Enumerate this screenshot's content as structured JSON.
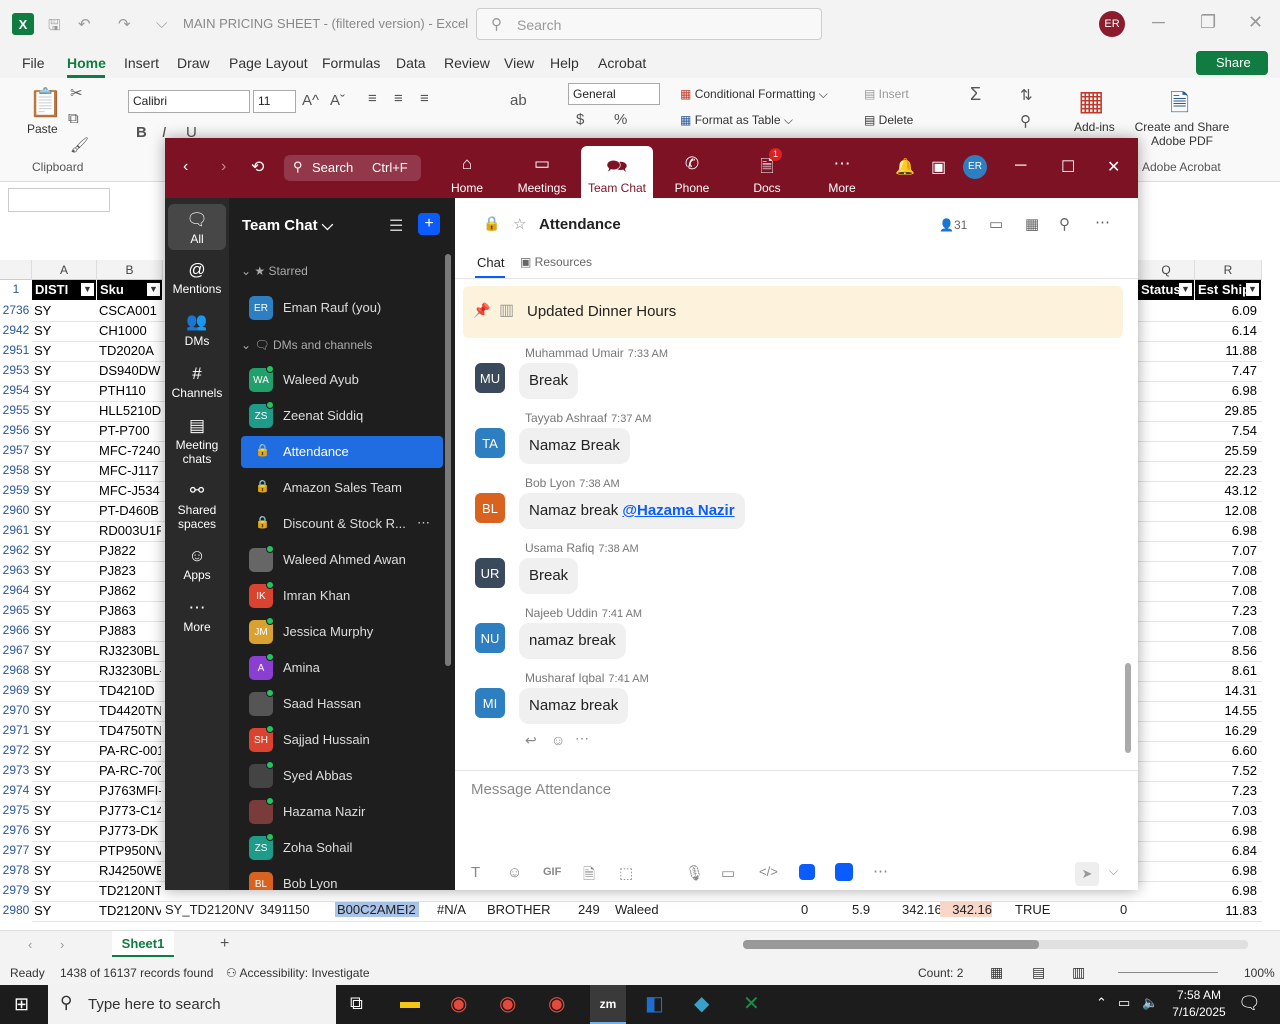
{
  "excel": {
    "title": "MAIN PRICING SHEET - (filtered version)  -  Excel",
    "search_placeholder": "Search",
    "avatar": "ER",
    "tabs": [
      "File",
      "Home",
      "Insert",
      "Draw",
      "Page Layout",
      "Formulas",
      "Data",
      "Review",
      "View",
      "Help",
      "Acrobat"
    ],
    "share": "Share",
    "ribbon": {
      "paste": "Paste",
      "clipboard": "Clipboard",
      "font": "Calibri",
      "size": "11",
      "number_format": "General",
      "conditional": "Conditional Formatting",
      "format_table": "Format as Table",
      "insert": "Insert",
      "delete": "Delete",
      "addins": "Add-ins",
      "create_pdf": "Create and Share Adobe PDF",
      "adobe": "Adobe Acrobat"
    },
    "columns": [
      "A",
      "B",
      "Q",
      "R"
    ],
    "headers": {
      "disti": "DISTI",
      "sku": "Sku",
      "status": "Status",
      "ship": "Est Ship"
    },
    "rows": [
      {
        "n": "2736",
        "a": "SY",
        "b": "CSCA001",
        "r": "6.09"
      },
      {
        "n": "2942",
        "a": "SY",
        "b": "CH1000",
        "r": "6.14"
      },
      {
        "n": "2951",
        "a": "SY",
        "b": "TD2020A",
        "r": "11.88"
      },
      {
        "n": "2953",
        "a": "SY",
        "b": "DS940DW",
        "r": "7.47"
      },
      {
        "n": "2954",
        "a": "SY",
        "b": "PTH110",
        "r": "6.98"
      },
      {
        "n": "2955",
        "a": "SY",
        "b": "HLL5210D",
        "r": "29.85"
      },
      {
        "n": "2956",
        "a": "SY",
        "b": "PT-P700",
        "r": "7.54"
      },
      {
        "n": "2957",
        "a": "SY",
        "b": "MFC-7240",
        "r": "25.59"
      },
      {
        "n": "2958",
        "a": "SY",
        "b": "MFC-J117",
        "r": "22.23"
      },
      {
        "n": "2959",
        "a": "SY",
        "b": "MFC-J534",
        "r": "43.12"
      },
      {
        "n": "2960",
        "a": "SY",
        "b": "PT-D460B",
        "r": "12.08"
      },
      {
        "n": "2961",
        "a": "SY",
        "b": "RD003U1F",
        "r": "6.98"
      },
      {
        "n": "2962",
        "a": "SY",
        "b": "PJ822",
        "r": "7.07"
      },
      {
        "n": "2963",
        "a": "SY",
        "b": "PJ823",
        "r": "7.08"
      },
      {
        "n": "2964",
        "a": "SY",
        "b": "PJ862",
        "r": "7.08"
      },
      {
        "n": "2965",
        "a": "SY",
        "b": "PJ863",
        "r": "7.23"
      },
      {
        "n": "2966",
        "a": "SY",
        "b": "PJ883",
        "r": "7.08"
      },
      {
        "n": "2967",
        "a": "SY",
        "b": "RJ3230BL",
        "r": "8.56"
      },
      {
        "n": "2968",
        "a": "SY",
        "b": "RJ3230BL-",
        "r": "8.61"
      },
      {
        "n": "2969",
        "a": "SY",
        "b": "TD4210D",
        "r": "14.31"
      },
      {
        "n": "2970",
        "a": "SY",
        "b": "TD4420TN",
        "r": "14.55"
      },
      {
        "n": "2971",
        "a": "SY",
        "b": "TD4750TN",
        "r": "16.29"
      },
      {
        "n": "2972",
        "a": "SY",
        "b": "PA-RC-001",
        "r": "6.60"
      },
      {
        "n": "2973",
        "a": "SY",
        "b": "PA-RC-700",
        "r": "7.52"
      },
      {
        "n": "2974",
        "a": "SY",
        "b": "PJ763MFI-",
        "r": "7.23"
      },
      {
        "n": "2975",
        "a": "SY",
        "b": "PJ773-C14",
        "r": "7.03"
      },
      {
        "n": "2976",
        "a": "SY",
        "b": "PJ773-DK",
        "r": "6.98"
      },
      {
        "n": "2977",
        "a": "SY",
        "b": "PTP950NV",
        "r": "6.84"
      },
      {
        "n": "2978",
        "a": "SY",
        "b": "RJ4250WB",
        "r": "6.98"
      },
      {
        "n": "2979",
        "a": "SY",
        "b": "TD2120NT",
        "r": "6.98"
      },
      {
        "n": "2980",
        "a": "SY",
        "b": "TD2120NV",
        "r": "11.83"
      }
    ],
    "row2980_extra": [
      "SY_TD2120NV",
      "3491150",
      "B00C2AMEI2",
      "#N/A",
      "BROTHER",
      "249",
      "Waleed",
      "0",
      "5.9",
      "342.16",
      "342.16",
      "TRUE",
      "0"
    ],
    "sheet_tab": "Sheet1",
    "status": {
      "ready": "Ready",
      "records": "1438 of 16137 records found",
      "access": "Accessibility: Investigate",
      "count": "Count: 2",
      "zoom": "100%"
    }
  },
  "zoom": {
    "search": "Search",
    "search_shortcut": "Ctrl+F",
    "nav": [
      {
        "label": "Home",
        "icon": "home-icon"
      },
      {
        "label": "Meetings",
        "icon": "video-icon"
      },
      {
        "label": "Team Chat",
        "icon": "chat-icon"
      },
      {
        "label": "Phone",
        "icon": "phone-icon"
      },
      {
        "label": "Docs",
        "icon": "doc-icon",
        "badge": "1"
      },
      {
        "label": "More",
        "icon": "more-icon"
      }
    ],
    "avatar": "ER",
    "rail": [
      "All",
      "Mentions",
      "DMs",
      "Channels",
      "Meeting chats",
      "Shared spaces",
      "Apps",
      "More"
    ],
    "sidebar_title": "Team Chat",
    "starred": "Starred",
    "dms_channels": "DMs and channels",
    "items": [
      {
        "label": "Eman Rauf (you)",
        "av": "ER",
        "color": "#2d7fc1"
      },
      {
        "label": "Waleed Ayub",
        "av": "WA",
        "color": "#22a06b"
      },
      {
        "label": "Zeenat Siddiq",
        "av": "ZS",
        "color": "#1e9c8a"
      },
      {
        "label": "Attendance",
        "av": "",
        "color": ""
      },
      {
        "label": "Amazon Sales Team",
        "av": "",
        "color": ""
      },
      {
        "label": "Discount & Stock R...",
        "av": "",
        "color": ""
      },
      {
        "label": "Waleed Ahmed Awan",
        "av": "",
        "color": "#666"
      },
      {
        "label": "Imran Khan",
        "av": "IK",
        "color": "#d9432f"
      },
      {
        "label": "Jessica Murphy",
        "av": "JM",
        "color": "#d9a12f"
      },
      {
        "label": "Amina",
        "av": "A",
        "color": "#8a3fd1"
      },
      {
        "label": "Saad Hassan",
        "av": "",
        "color": "#555"
      },
      {
        "label": "Sajjad Hussain",
        "av": "SH",
        "color": "#d9432f"
      },
      {
        "label": "Syed Abbas",
        "av": "",
        "color": "#444"
      },
      {
        "label": "Hazama Nazir",
        "av": "",
        "color": "#7a3b3b"
      },
      {
        "label": "Zoha Sohail",
        "av": "ZS",
        "color": "#1e9c8a"
      },
      {
        "label": "Bob Lyon",
        "av": "BL",
        "color": "#d9621f"
      }
    ],
    "channel": {
      "name": "Attendance",
      "members": "31",
      "tab_chat": "Chat",
      "tab_resources": "Resources"
    },
    "pinned": "Updated Dinner Hours",
    "messages": [
      {
        "av": "MU",
        "color": "#3a4a5c",
        "name": "Muhammad Umair",
        "time": "7:33 AM",
        "text": "Break"
      },
      {
        "av": "TA",
        "color": "#2d7fc1",
        "name": "Tayyab Ashraaf",
        "time": "7:37 AM",
        "text": "Namaz Break"
      },
      {
        "av": "BL",
        "color": "#d9621f",
        "name": "Bob Lyon",
        "time": "7:38 AM",
        "text": "Namaz break ",
        "mention": "@Hazama Nazir"
      },
      {
        "av": "UR",
        "color": "#3a4a5c",
        "name": "Usama Rafiq",
        "time": "7:38 AM",
        "text": "Break"
      },
      {
        "av": "NU",
        "color": "#2d7fc1",
        "name": "Najeeb Uddin",
        "time": "7:41 AM",
        "text": "namaz break"
      },
      {
        "av": "MI",
        "color": "#2d7fc1",
        "name": "Musharaf Iqbal",
        "time": "7:41 AM",
        "text": "Namaz break"
      }
    ],
    "compose_placeholder": "Message Attendance"
  },
  "taskbar": {
    "search": "Type here to search",
    "time": "7:58 AM",
    "date": "7/16/2025"
  }
}
